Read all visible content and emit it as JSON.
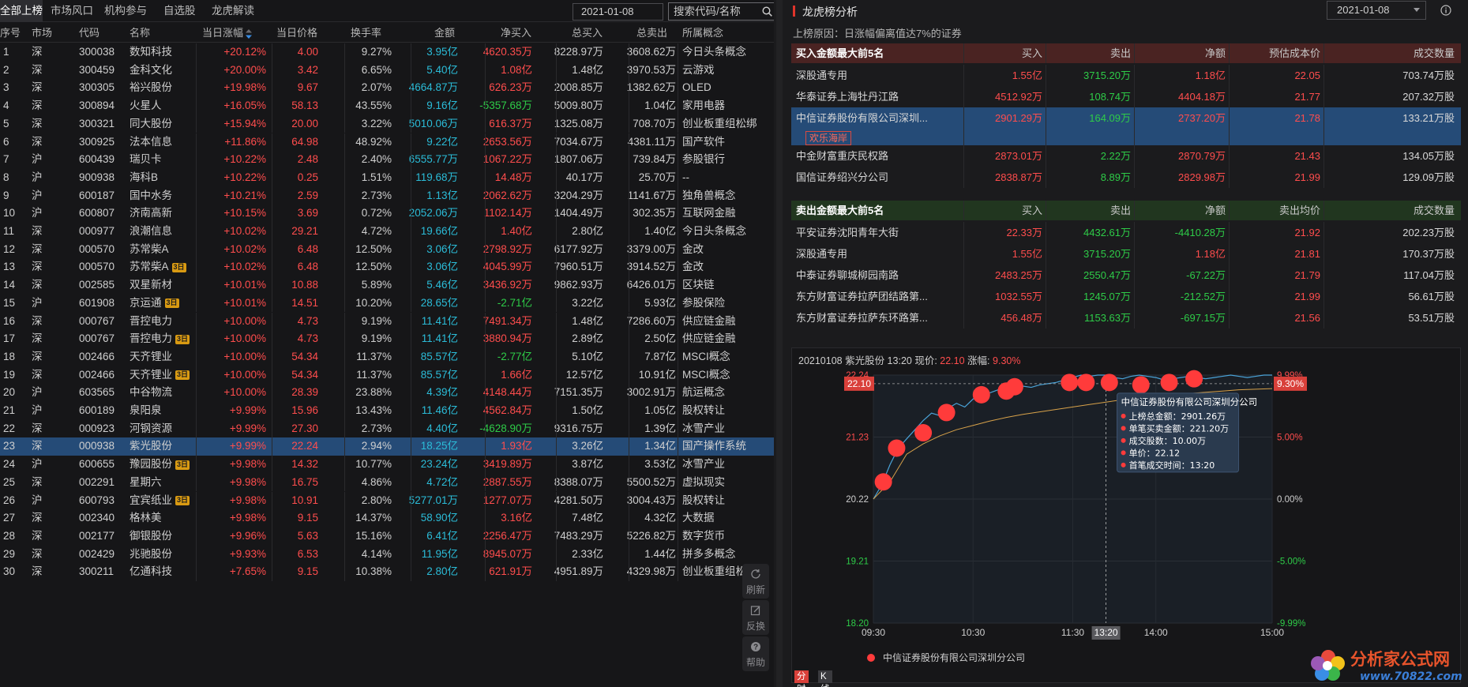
{
  "left": {
    "tabs": [
      "全部上榜",
      "市场风口",
      "机构参与",
      "自选股",
      "龙虎解读"
    ],
    "date": "2021-01-08",
    "search_placeholder": "搜索代码/名称",
    "columns": [
      "序号",
      "市场",
      "代码",
      "名称",
      "当日涨幅",
      "当日价格",
      "换手率",
      "金额",
      "净买入",
      "总买入",
      "总卖出",
      "所属概念"
    ],
    "rows": [
      {
        "idx": "1",
        "mkt": "深",
        "code": "300038",
        "name": "数知科技",
        "badge": "",
        "chg": "+20.12%",
        "price": "4.00",
        "turn": "9.27%",
        "amt": "3.95亿",
        "net": "4620.35万",
        "net_dir": "up",
        "buy": "8228.97万",
        "sell": "3608.62万",
        "concept": "今日头条概念"
      },
      {
        "idx": "2",
        "mkt": "深",
        "code": "300459",
        "name": "金科文化",
        "badge": "",
        "chg": "+20.00%",
        "price": "3.42",
        "turn": "6.65%",
        "amt": "5.40亿",
        "net": "1.08亿",
        "net_dir": "up",
        "buy": "1.48亿",
        "sell": "3970.53万",
        "concept": "云游戏"
      },
      {
        "idx": "3",
        "mkt": "深",
        "code": "300305",
        "name": "裕兴股份",
        "badge": "",
        "chg": "+19.98%",
        "price": "9.67",
        "turn": "2.07%",
        "amt": "4664.87万",
        "net": "626.23万",
        "net_dir": "up",
        "buy": "2008.85万",
        "sell": "1382.62万",
        "concept": "OLED"
      },
      {
        "idx": "4",
        "mkt": "深",
        "code": "300894",
        "name": "火星人",
        "badge": "",
        "chg": "+16.05%",
        "price": "58.13",
        "turn": "43.55%",
        "amt": "9.16亿",
        "net": "-5357.68万",
        "net_dir": "down",
        "buy": "5009.80万",
        "sell": "1.04亿",
        "concept": "家用电器"
      },
      {
        "idx": "5",
        "mkt": "深",
        "code": "300321",
        "name": "同大股份",
        "badge": "",
        "chg": "+15.94%",
        "price": "20.00",
        "turn": "3.22%",
        "amt": "5010.06万",
        "net": "616.37万",
        "net_dir": "up",
        "buy": "1325.08万",
        "sell": "708.70万",
        "concept": "创业板重组松绑"
      },
      {
        "idx": "6",
        "mkt": "深",
        "code": "300925",
        "name": "法本信息",
        "badge": "",
        "chg": "+11.86%",
        "price": "64.98",
        "turn": "48.92%",
        "amt": "9.22亿",
        "net": "2653.56万",
        "net_dir": "up",
        "buy": "7034.67万",
        "sell": "4381.11万",
        "concept": "国产软件"
      },
      {
        "idx": "7",
        "mkt": "沪",
        "code": "600439",
        "name": "瑞贝卡",
        "badge": "",
        "chg": "+10.22%",
        "price": "2.48",
        "turn": "2.40%",
        "amt": "6555.77万",
        "net": "1067.22万",
        "net_dir": "up",
        "buy": "1807.06万",
        "sell": "739.84万",
        "concept": "参股银行"
      },
      {
        "idx": "8",
        "mkt": "沪",
        "code": "900938",
        "name": "海科B",
        "badge": "",
        "chg": "+10.22%",
        "price": "0.25",
        "turn": "1.51%",
        "amt": "119.68万",
        "net": "14.48万",
        "net_dir": "up",
        "buy": "40.17万",
        "sell": "25.70万",
        "concept": "--"
      },
      {
        "idx": "9",
        "mkt": "沪",
        "code": "600187",
        "name": "国中水务",
        "badge": "",
        "chg": "+10.21%",
        "price": "2.59",
        "turn": "2.73%",
        "amt": "1.13亿",
        "net": "2062.62万",
        "net_dir": "up",
        "buy": "3204.29万",
        "sell": "1141.67万",
        "concept": "独角兽概念"
      },
      {
        "idx": "10",
        "mkt": "沪",
        "code": "600807",
        "name": "济南高新",
        "badge": "",
        "chg": "+10.15%",
        "price": "3.69",
        "turn": "0.72%",
        "amt": "2052.06万",
        "net": "1102.14万",
        "net_dir": "up",
        "buy": "1404.49万",
        "sell": "302.35万",
        "concept": "互联网金融"
      },
      {
        "idx": "11",
        "mkt": "深",
        "code": "000977",
        "name": "浪潮信息",
        "badge": "",
        "chg": "+10.02%",
        "price": "29.21",
        "turn": "4.72%",
        "amt": "19.66亿",
        "net": "1.40亿",
        "net_dir": "up",
        "buy": "2.80亿",
        "sell": "1.40亿",
        "concept": "今日头条概念"
      },
      {
        "idx": "12",
        "mkt": "深",
        "code": "000570",
        "name": "苏常柴A",
        "badge": "",
        "chg": "+10.02%",
        "price": "6.48",
        "turn": "12.50%",
        "amt": "3.06亿",
        "net": "2798.92万",
        "net_dir": "up",
        "buy": "6177.92万",
        "sell": "3379.00万",
        "concept": "金改"
      },
      {
        "idx": "13",
        "mkt": "深",
        "code": "000570",
        "name": "苏常柴A",
        "badge": "3日",
        "chg": "+10.02%",
        "price": "6.48",
        "turn": "12.50%",
        "amt": "3.06亿",
        "net": "4045.99万",
        "net_dir": "up",
        "buy": "7960.51万",
        "sell": "3914.52万",
        "concept": "金改"
      },
      {
        "idx": "14",
        "mkt": "深",
        "code": "002585",
        "name": "双星新材",
        "badge": "",
        "chg": "+10.01%",
        "price": "10.88",
        "turn": "5.89%",
        "amt": "5.46亿",
        "net": "3436.92万",
        "net_dir": "up",
        "buy": "9862.93万",
        "sell": "6426.01万",
        "concept": "区块链"
      },
      {
        "idx": "15",
        "mkt": "沪",
        "code": "601908",
        "name": "京运通",
        "badge": "3日",
        "chg": "+10.01%",
        "price": "14.51",
        "turn": "10.20%",
        "amt": "28.65亿",
        "net": "-2.71亿",
        "net_dir": "down",
        "buy": "3.22亿",
        "sell": "5.93亿",
        "concept": "参股保险"
      },
      {
        "idx": "16",
        "mkt": "深",
        "code": "000767",
        "name": "晋控电力",
        "badge": "",
        "chg": "+10.00%",
        "price": "4.73",
        "turn": "9.19%",
        "amt": "11.41亿",
        "net": "7491.34万",
        "net_dir": "up",
        "buy": "1.48亿",
        "sell": "7286.60万",
        "concept": "供应链金融"
      },
      {
        "idx": "17",
        "mkt": "深",
        "code": "000767",
        "name": "晋控电力",
        "badge": "3日",
        "chg": "+10.00%",
        "price": "4.73",
        "turn": "9.19%",
        "amt": "11.41亿",
        "net": "3880.94万",
        "net_dir": "up",
        "buy": "2.89亿",
        "sell": "2.50亿",
        "concept": "供应链金融"
      },
      {
        "idx": "18",
        "mkt": "深",
        "code": "002466",
        "name": "天齐锂业",
        "badge": "",
        "chg": "+10.00%",
        "price": "54.34",
        "turn": "11.37%",
        "amt": "85.57亿",
        "net": "-2.77亿",
        "net_dir": "down",
        "buy": "5.10亿",
        "sell": "7.87亿",
        "concept": "MSCI概念"
      },
      {
        "idx": "19",
        "mkt": "深",
        "code": "002466",
        "name": "天齐锂业",
        "badge": "3日",
        "chg": "+10.00%",
        "price": "54.34",
        "turn": "11.37%",
        "amt": "85.57亿",
        "net": "1.66亿",
        "net_dir": "up",
        "buy": "12.57亿",
        "sell": "10.91亿",
        "concept": "MSCI概念"
      },
      {
        "idx": "20",
        "mkt": "沪",
        "code": "603565",
        "name": "中谷物流",
        "badge": "",
        "chg": "+10.00%",
        "price": "28.39",
        "turn": "23.88%",
        "amt": "4.39亿",
        "net": "4148.44万",
        "net_dir": "up",
        "buy": "7151.35万",
        "sell": "3002.91万",
        "concept": "航运概念"
      },
      {
        "idx": "21",
        "mkt": "沪",
        "code": "600189",
        "name": "泉阳泉",
        "badge": "",
        "chg": "+9.99%",
        "price": "15.96",
        "turn": "13.43%",
        "amt": "11.46亿",
        "net": "4562.84万",
        "net_dir": "up",
        "buy": "1.50亿",
        "sell": "1.05亿",
        "concept": "股权转让"
      },
      {
        "idx": "22",
        "mkt": "深",
        "code": "000923",
        "name": "河钢资源",
        "badge": "",
        "chg": "+9.99%",
        "price": "27.30",
        "turn": "2.73%",
        "amt": "4.40亿",
        "net": "-4628.90万",
        "net_dir": "down",
        "buy": "9316.75万",
        "sell": "1.39亿",
        "concept": "冰雪产业"
      },
      {
        "idx": "23",
        "mkt": "深",
        "code": "000938",
        "name": "紫光股份",
        "badge": "",
        "chg": "+9.99%",
        "price": "22.24",
        "turn": "2.94%",
        "amt": "18.25亿",
        "net": "1.93亿",
        "net_dir": "up",
        "buy": "3.26亿",
        "sell": "1.34亿",
        "concept": "国产操作系统",
        "selected": true
      },
      {
        "idx": "24",
        "mkt": "沪",
        "code": "600655",
        "name": "豫园股份",
        "badge": "3日",
        "chg": "+9.98%",
        "price": "14.32",
        "turn": "10.77%",
        "amt": "23.24亿",
        "net": "3419.89万",
        "net_dir": "up",
        "buy": "3.87亿",
        "sell": "3.53亿",
        "concept": "冰雪产业"
      },
      {
        "idx": "25",
        "mkt": "深",
        "code": "002291",
        "name": "星期六",
        "badge": "",
        "chg": "+9.98%",
        "price": "16.75",
        "turn": "4.86%",
        "amt": "4.72亿",
        "net": "2887.55万",
        "net_dir": "up",
        "buy": "8388.07万",
        "sell": "5500.52万",
        "concept": "虚拟现实"
      },
      {
        "idx": "26",
        "mkt": "沪",
        "code": "600793",
        "name": "宜宾纸业",
        "badge": "3日",
        "chg": "+9.98%",
        "price": "10.91",
        "turn": "2.80%",
        "amt": "5277.01万",
        "net": "1277.07万",
        "net_dir": "up",
        "buy": "4281.50万",
        "sell": "3004.43万",
        "concept": "股权转让"
      },
      {
        "idx": "27",
        "mkt": "深",
        "code": "002340",
        "name": "格林美",
        "badge": "",
        "chg": "+9.98%",
        "price": "9.15",
        "turn": "14.37%",
        "amt": "58.90亿",
        "net": "3.16亿",
        "net_dir": "up",
        "buy": "7.48亿",
        "sell": "4.32亿",
        "concept": "大数据"
      },
      {
        "idx": "28",
        "mkt": "深",
        "code": "002177",
        "name": "御银股份",
        "badge": "",
        "chg": "+9.96%",
        "price": "5.63",
        "turn": "15.16%",
        "amt": "6.41亿",
        "net": "2256.47万",
        "net_dir": "up",
        "buy": "7483.29万",
        "sell": "5226.82万",
        "concept": "数字货币"
      },
      {
        "idx": "29",
        "mkt": "深",
        "code": "002429",
        "name": "兆驰股份",
        "badge": "",
        "chg": "+9.93%",
        "price": "6.53",
        "turn": "4.14%",
        "amt": "11.95亿",
        "net": "8945.07万",
        "net_dir": "up",
        "buy": "2.33亿",
        "sell": "1.44亿",
        "concept": "拼多多概念"
      },
      {
        "idx": "30",
        "mkt": "深",
        "code": "300211",
        "name": "亿通科技",
        "badge": "",
        "chg": "+7.65%",
        "price": "9.15",
        "turn": "10.38%",
        "amt": "2.80亿",
        "net": "621.91万",
        "net_dir": "up",
        "buy": "4951.89万",
        "sell": "4329.98万",
        "concept": "创业板重组松绑"
      }
    ],
    "tools": [
      "刷新",
      "反换",
      "帮助"
    ]
  },
  "right": {
    "title": "龙虎榜分析",
    "date": "2021-01-08",
    "reason": "上榜原因：日涨幅偏离值达7%的证券",
    "buy_table": {
      "title": "买入金额最大前5名",
      "columns": [
        "买入",
        "卖出",
        "净额",
        "预估成本价",
        "成交数量"
      ],
      "rows": [
        {
          "name": "深股通专用",
          "buy": "1.55亿",
          "sell": "3715.20万",
          "net": "1.18亿",
          "cost": "22.05",
          "vol": "703.74万股"
        },
        {
          "name": "华泰证券上海牡丹江路",
          "buy": "4512.92万",
          "sell": "108.74万",
          "net": "4404.18万",
          "cost": "21.77",
          "vol": "207.32万股"
        },
        {
          "name": "中信证券股份有限公司深圳...",
          "buy": "2901.29万",
          "sell": "164.09万",
          "net": "2737.20万",
          "cost": "21.78",
          "vol": "133.21万股",
          "tag": "欢乐海岸",
          "selected": true
        },
        {
          "name": "中金财富重庆民权路",
          "buy": "2873.01万",
          "sell": "2.22万",
          "net": "2870.79万",
          "cost": "21.43",
          "vol": "134.05万股"
        },
        {
          "name": "国信证券绍兴分公司",
          "buy": "2838.87万",
          "sell": "8.89万",
          "net": "2829.98万",
          "cost": "21.99",
          "vol": "129.09万股"
        }
      ]
    },
    "sell_table": {
      "title": "卖出金额最大前5名",
      "columns": [
        "买入",
        "卖出",
        "净额",
        "卖出均价",
        "成交数量"
      ],
      "rows": [
        {
          "name": "平安证券沈阳青年大街",
          "buy": "22.33万",
          "sell": "4432.61万",
          "net": "-4410.28万",
          "cost": "21.92",
          "vol": "202.23万股",
          "net_dir": "down"
        },
        {
          "name": "深股通专用",
          "buy": "1.55亿",
          "sell": "3715.20万",
          "net": "1.18亿",
          "cost": "21.81",
          "vol": "170.37万股",
          "net_dir": "up"
        },
        {
          "name": "中泰证券聊城柳园南路",
          "buy": "2483.25万",
          "sell": "2550.47万",
          "net": "-67.22万",
          "cost": "21.79",
          "vol": "117.04万股",
          "net_dir": "down"
        },
        {
          "name": "东方财富证券拉萨团结路第...",
          "buy": "1032.55万",
          "sell": "1245.07万",
          "net": "-212.52万",
          "cost": "21.99",
          "vol": "56.61万股",
          "net_dir": "down"
        },
        {
          "name": "东方财富证券拉萨东环路第...",
          "buy": "456.48万",
          "sell": "1153.63万",
          "net": "-697.15万",
          "cost": "21.56",
          "vol": "53.51万股",
          "net_dir": "down"
        }
      ]
    },
    "chart": {
      "header_prefix": "20210108 紫光股份 13:20 现价:",
      "price": "22.10",
      "chg_label": "涨幅:",
      "chg": "9.30%",
      "current_price_tag": "22.10",
      "current_pct_tag": "9.30%",
      "cursor_time": "13:20",
      "tooltip": {
        "title": "中信证券股份有限公司深圳分公司",
        "lines": [
          "上榜总金额：2901.26万",
          "单笔买卖金额：221.20万",
          "成交股数：10.00万",
          "单价：22.12",
          "首笔成交时间：13:20"
        ]
      },
      "legend": "中信证券股份有限公司深圳分公司",
      "tabs": [
        "分时",
        "K线"
      ]
    },
    "watermark": {
      "text": "分析家公式网",
      "url": "www.70822.com"
    }
  },
  "chart_data": {
    "type": "line",
    "title": "20210108 紫光股份 13:20",
    "x_ticks": [
      "09:30",
      "10:30",
      "11:30",
      "13:20",
      "14:00",
      "15:00"
    ],
    "y_left_ticks": [
      "22.24",
      "21.23",
      "20.22",
      "19.21",
      "18.20"
    ],
    "y_right_ticks": [
      "9.99%",
      "5.00%",
      "0.00%",
      "-5.00%",
      "-9.99%"
    ],
    "ylim": [
      18.2,
      22.24
    ],
    "series": [
      {
        "name": "价格",
        "color": "#4aa3d8",
        "x": [
          0,
          5,
          10,
          15,
          20,
          25,
          30,
          35,
          40,
          45,
          50,
          55,
          60,
          65,
          70,
          75,
          80,
          85,
          90,
          95,
          100,
          105,
          110,
          115,
          120,
          125,
          130,
          135,
          140,
          145,
          150,
          155,
          160,
          165,
          170,
          175,
          180,
          185,
          190,
          195,
          200,
          205,
          210,
          215,
          220,
          225,
          230,
          235,
          240
        ],
        "values": [
          20.22,
          20.45,
          20.78,
          21.05,
          21.2,
          21.35,
          21.5,
          21.62,
          21.58,
          21.7,
          21.78,
          21.72,
          21.85,
          21.9,
          21.95,
          22.0,
          21.92,
          22.02,
          22.06,
          22.04,
          22.08,
          22.1,
          22.12,
          22.16,
          22.2,
          22.24,
          22.22,
          22.24,
          22.24,
          22.2,
          22.18,
          22.22,
          22.24,
          22.22,
          22.2,
          22.16,
          22.18,
          22.2,
          22.22,
          22.2,
          22.18,
          22.2,
          22.22,
          22.24,
          22.22,
          22.2,
          22.22,
          22.24,
          22.24
        ]
      },
      {
        "name": "均价",
        "color": "#d8a24a",
        "x": [
          0,
          10,
          20,
          30,
          40,
          50,
          60,
          70,
          80,
          90,
          100,
          110,
          120,
          130,
          140,
          150,
          160,
          170,
          180,
          190,
          200,
          210,
          220,
          230,
          240
        ],
        "values": [
          20.22,
          20.5,
          20.95,
          21.12,
          21.25,
          21.35,
          21.42,
          21.49,
          21.55,
          21.6,
          21.64,
          21.68,
          21.72,
          21.76,
          21.8,
          21.84,
          21.87,
          21.9,
          21.92,
          21.94,
          21.96,
          21.98,
          22.0,
          22.01,
          22.02
        ]
      }
    ],
    "trade_markers_x": [
      6,
      14,
      30,
      44,
      65,
      80,
      85,
      118,
      128,
      142,
      161,
      178,
      193
    ],
    "trade_markers_y": [
      20.5,
      21.05,
      21.3,
      21.63,
      21.92,
      21.98,
      22.05,
      22.12,
      22.12,
      22.12,
      22.08,
      22.12,
      22.18
    ]
  }
}
